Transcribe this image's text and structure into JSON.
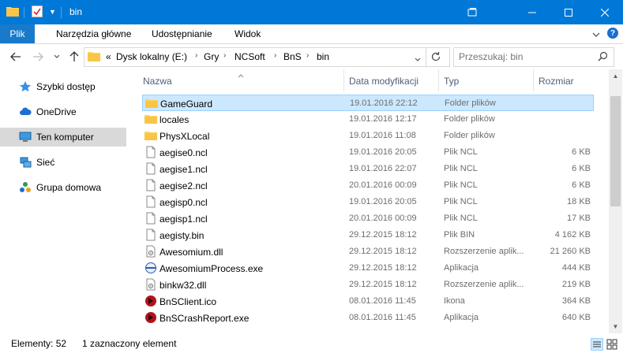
{
  "window": {
    "title": "bin",
    "accent": "#0078d7"
  },
  "ribbon": {
    "file_tab": "Plik",
    "tabs": [
      "Narzędzia główne",
      "Udostępnianie",
      "Widok"
    ]
  },
  "address": {
    "overflow": "«",
    "crumbs": [
      "Dysk lokalny (E:)",
      "Gry",
      "NCSoft",
      "BnS",
      "bin"
    ]
  },
  "search": {
    "placeholder": "Przeszukaj: bin"
  },
  "nav": {
    "items": [
      {
        "label": "Szybki dostęp",
        "icon": "star-icon"
      },
      {
        "label": "OneDrive",
        "icon": "cloud-icon"
      },
      {
        "label": "Ten komputer",
        "icon": "computer-icon"
      },
      {
        "label": "Sieć",
        "icon": "network-icon"
      },
      {
        "label": "Grupa domowa",
        "icon": "homegroup-icon"
      }
    ]
  },
  "columns": {
    "name": "Nazwa",
    "date": "Data modyfikacji",
    "type": "Typ",
    "size": "Rozmiar"
  },
  "files": [
    {
      "name": "GameGuard",
      "date": "19.01.2016 22:12",
      "type": "Folder plików",
      "size": "",
      "icon": "folder-icon"
    },
    {
      "name": "locales",
      "date": "19.01.2016 12:17",
      "type": "Folder plików",
      "size": "",
      "icon": "folder-icon"
    },
    {
      "name": "PhysXLocal",
      "date": "19.01.2016 11:08",
      "type": "Folder plików",
      "size": "",
      "icon": "folder-icon"
    },
    {
      "name": "aegise0.ncl",
      "date": "19.01.2016 20:05",
      "type": "Plik NCL",
      "size": "6 KB",
      "icon": "file-icon"
    },
    {
      "name": "aegise1.ncl",
      "date": "19.01.2016 22:07",
      "type": "Plik NCL",
      "size": "6 KB",
      "icon": "file-icon"
    },
    {
      "name": "aegise2.ncl",
      "date": "20.01.2016 00:09",
      "type": "Plik NCL",
      "size": "6 KB",
      "icon": "file-icon"
    },
    {
      "name": "aegisp0.ncl",
      "date": "19.01.2016 20:05",
      "type": "Plik NCL",
      "size": "18 KB",
      "icon": "file-icon"
    },
    {
      "name": "aegisp1.ncl",
      "date": "20.01.2016 00:09",
      "type": "Plik NCL",
      "size": "17 KB",
      "icon": "file-icon"
    },
    {
      "name": "aegisty.bin",
      "date": "29.12.2015 18:12",
      "type": "Plik BIN",
      "size": "4 162 KB",
      "icon": "file-icon"
    },
    {
      "name": "Awesomium.dll",
      "date": "29.12.2015 18:12",
      "type": "Rozszerzenie aplik...",
      "size": "21 260 KB",
      "icon": "dll-icon"
    },
    {
      "name": "AwesomiumProcess.exe",
      "date": "29.12.2015 18:12",
      "type": "Aplikacja",
      "size": "444 KB",
      "icon": "exe-icon"
    },
    {
      "name": "binkw32.dll",
      "date": "29.12.2015 18:12",
      "type": "Rozszerzenie aplik...",
      "size": "219 KB",
      "icon": "dll-icon"
    },
    {
      "name": "BnSClient.ico",
      "date": "08.01.2016 11:45",
      "type": "Ikona",
      "size": "364 KB",
      "icon": "bns-icon"
    },
    {
      "name": "BnSCrashReport.exe",
      "date": "08.01.2016 11:45",
      "type": "Aplikacja",
      "size": "640 KB",
      "icon": "bns-icon"
    }
  ],
  "status": {
    "count": "Elementy: 52",
    "selection": "1 zaznaczony element"
  }
}
